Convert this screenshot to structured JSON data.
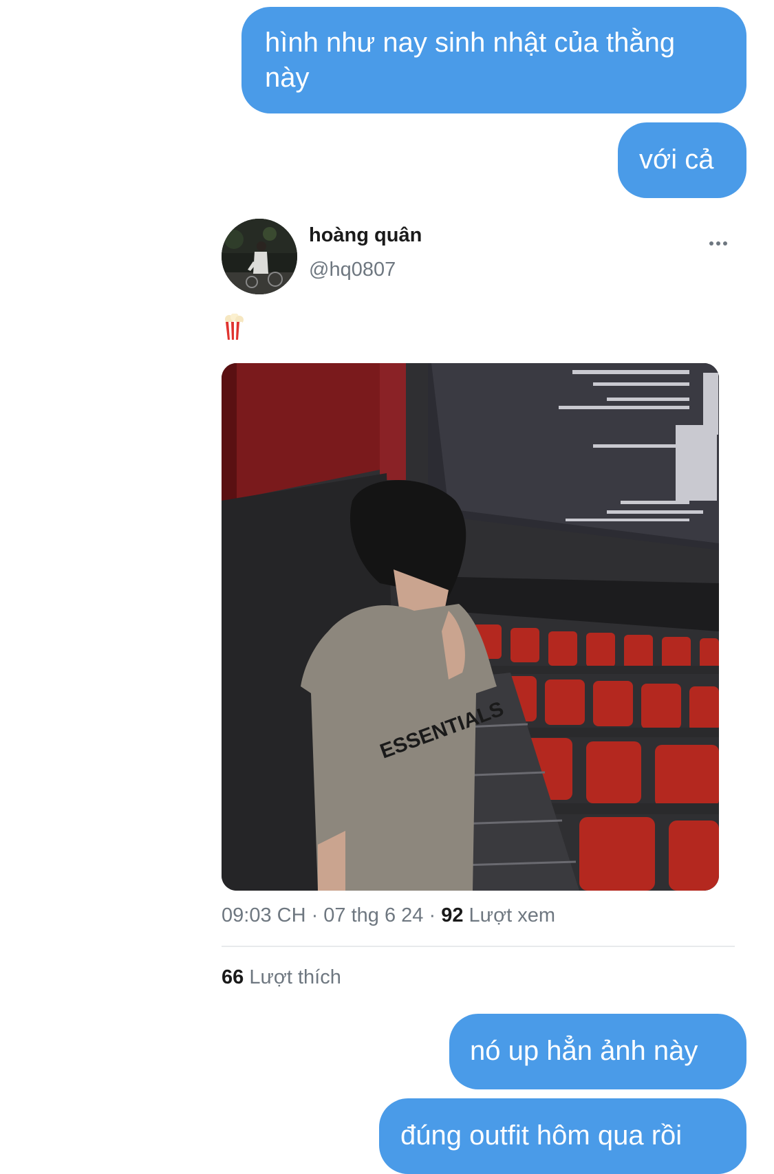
{
  "messages": {
    "m1": "hình như nay sinh nhật của thằng này",
    "m2": "với cả",
    "m3": "nó up hẳn ảnh này",
    "m4": "đúng outfit hôm qua rồi"
  },
  "tweet": {
    "author_name": "hoàng quân",
    "handle": "@hq0807",
    "emoji": "🍿",
    "time": "09:03 CH",
    "date": "07 thg 6 24",
    "views_count": "92",
    "views_label": "Lượt xem",
    "likes_count": "66",
    "likes_label": "Lượt thích",
    "more_icon": "more-horizontal-icon",
    "photo_text": "ESSENTIALS"
  },
  "colors": {
    "bubble": "#4a9be8",
    "secondary_text": "#6e7780",
    "primary_text": "#1a1a1a"
  }
}
